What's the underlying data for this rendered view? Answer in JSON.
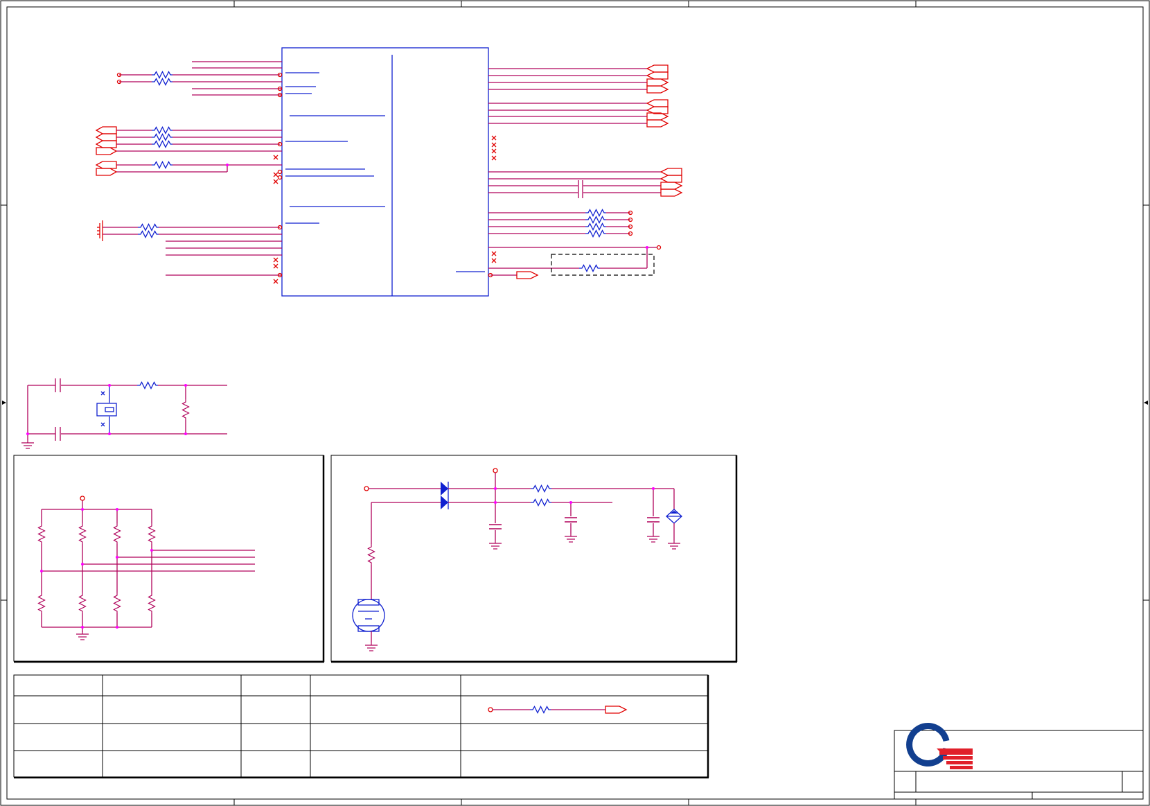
{
  "colors": {
    "wire": "#b0005a",
    "component": "#1020d0",
    "port": "#e00000",
    "junction": "#ff00ff",
    "frame": "#000000",
    "logo_blue": "#123f8f",
    "logo_red": "#e0202a"
  },
  "icons": [
    "company-logo-icon",
    "resistor-icon",
    "capacitor-icon",
    "crystal-icon",
    "diode-icon",
    "battery-icon",
    "ground-icon",
    "off-page-port-icon"
  ]
}
